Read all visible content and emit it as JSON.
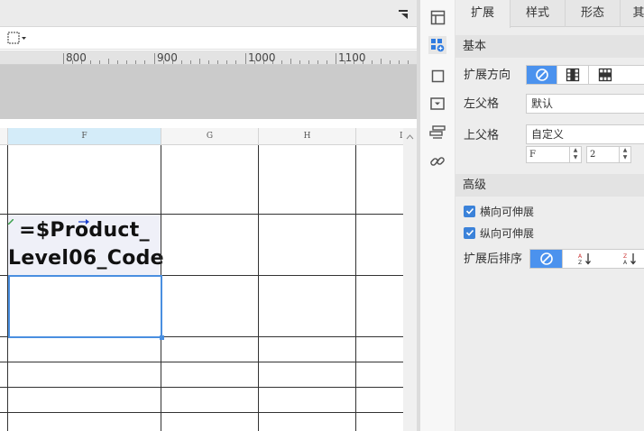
{
  "editor": {
    "ruler_labels": [
      "800",
      "900",
      "1000",
      "1100"
    ],
    "column_headers": [
      "F",
      "G",
      "H",
      "I"
    ],
    "formula_line1": "=$Product_",
    "formula_line2": "Level06_Code"
  },
  "icons": {
    "panel_toggle": "collapse-icon",
    "border_tool": "border-dropdown-icon",
    "side": [
      "cell-element-icon",
      "expand-icon",
      "cell-style-icon",
      "widget-icon",
      "hyperlink-stack-icon",
      "link-icon"
    ]
  },
  "panel": {
    "tabs": [
      "扩展",
      "样式",
      "形态",
      "其"
    ],
    "basic_section": "基本",
    "expand_direction_label": "扩展方向",
    "left_parent_label": "左父格",
    "left_parent_value": "默认",
    "top_parent_label": "上父格",
    "top_parent_value": "自定义",
    "top_parent_col": "F",
    "top_parent_row": "2",
    "advanced_section": "高级",
    "horizontal_expand_label": "横向可伸展",
    "vertical_expand_label": "纵向可伸展",
    "sort_after_expand_label": "扩展后排序"
  },
  "colors": {
    "accent": "#4b92ee",
    "selection": "#4a8fe0",
    "column_highlight": "#d4ecf9"
  }
}
